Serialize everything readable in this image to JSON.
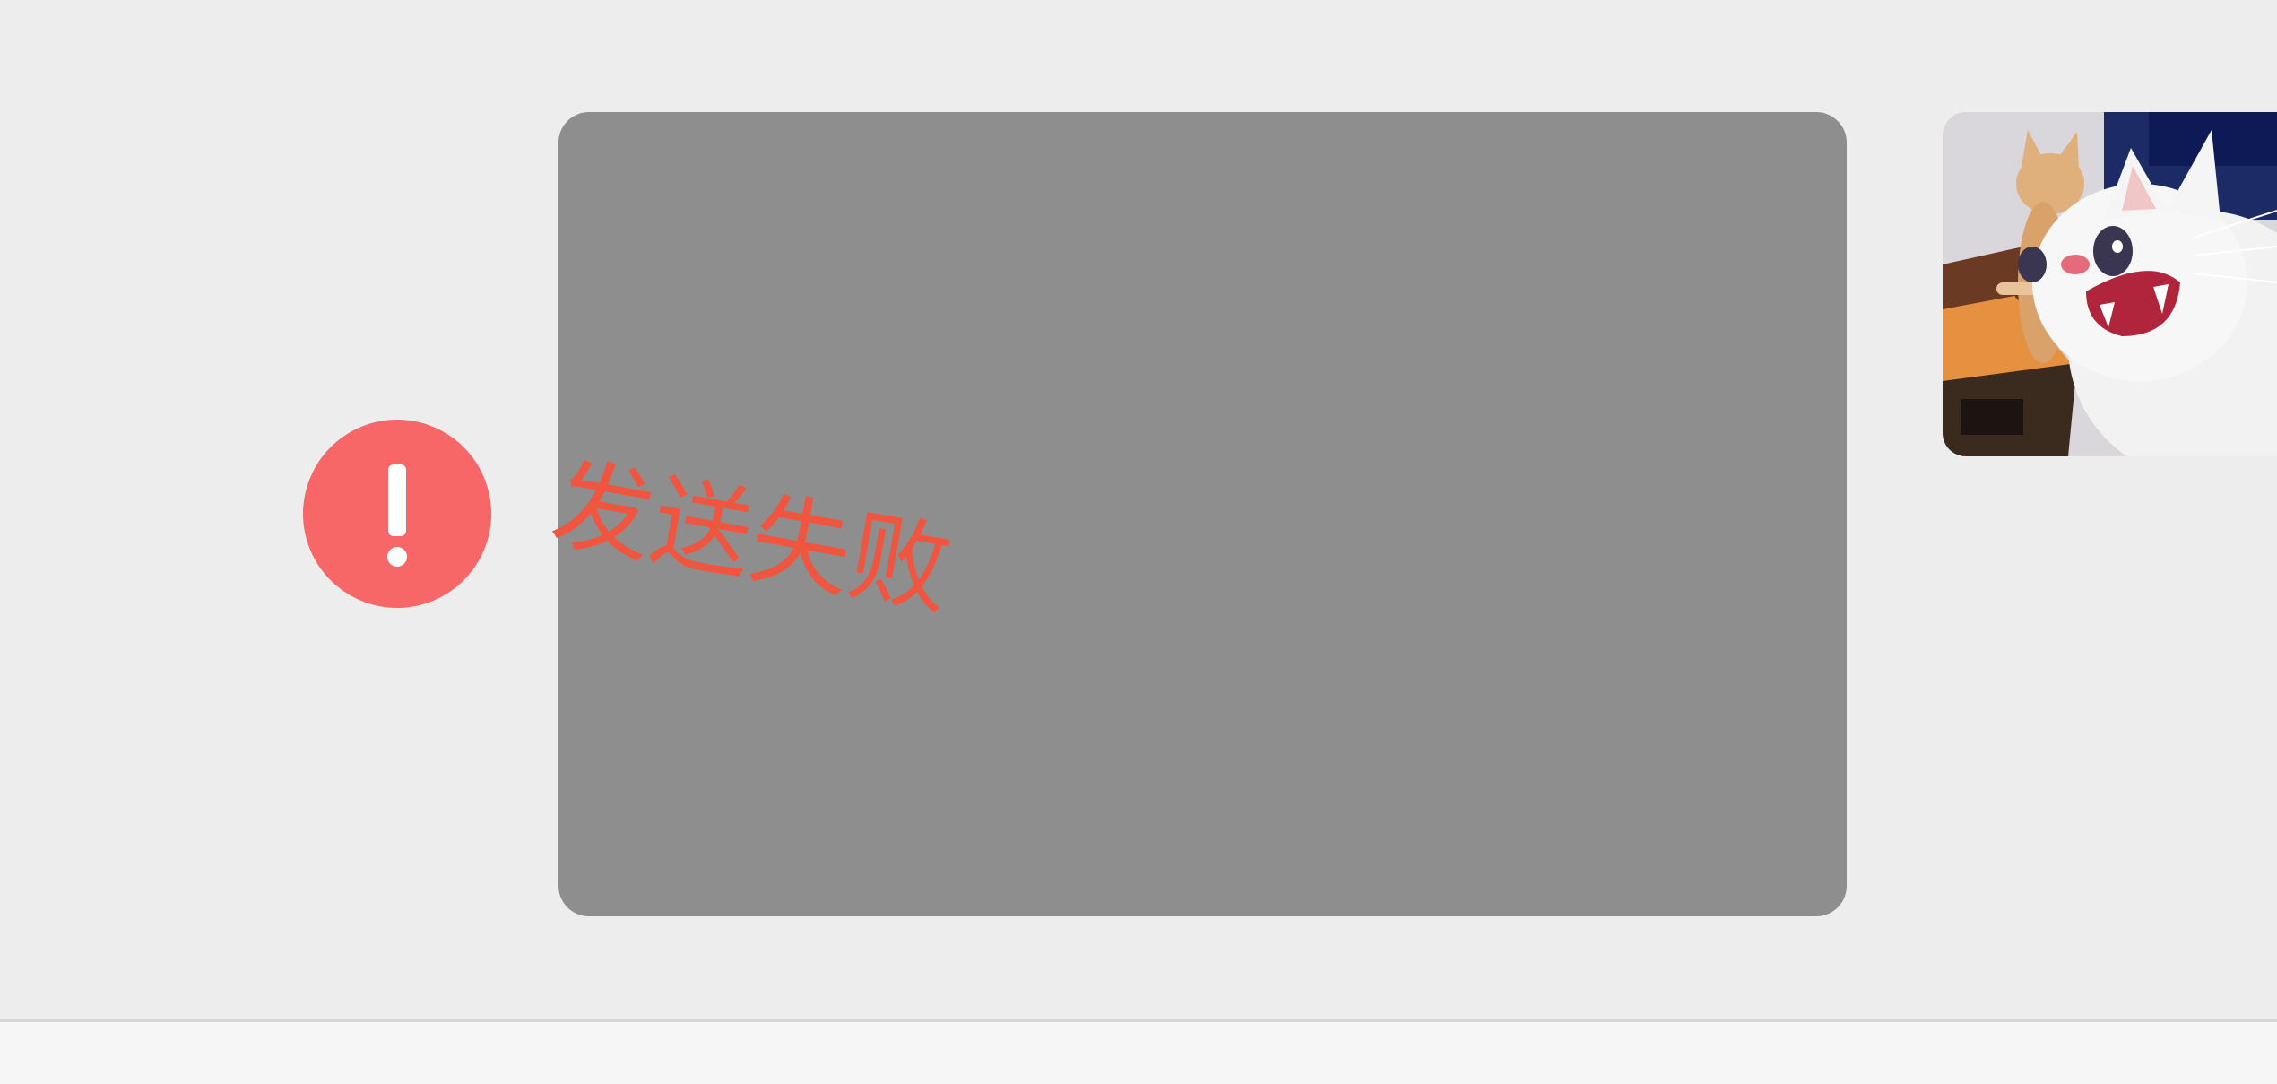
{
  "message": {
    "status_text": "发送失败",
    "status_color": "#f0553f",
    "error_icon": "exclamation-circle-icon",
    "error_icon_color": "#f76767",
    "image_placeholder_color": "#8e8e8e"
  },
  "avatar": {
    "icon": "cat-photo-avatar"
  },
  "colors": {
    "chat_background": "#ededed",
    "input_bar_background": "#f6f6f6"
  }
}
